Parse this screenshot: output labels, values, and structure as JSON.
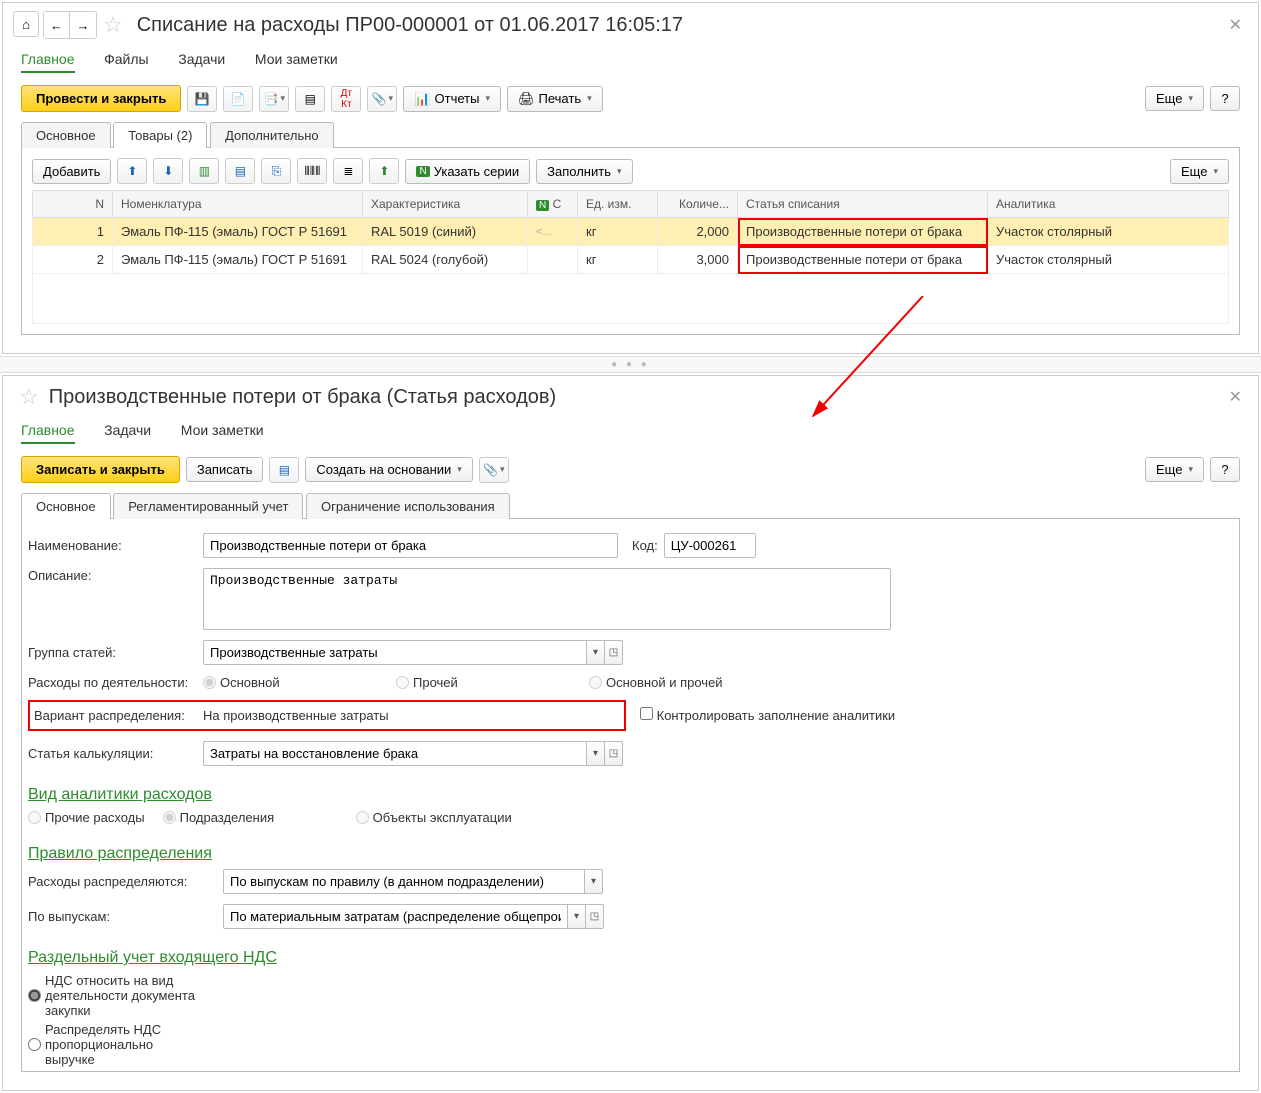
{
  "upper": {
    "title": "Списание на расходы ПР00-000001 от 01.06.2017 16:05:17",
    "nav_tabs": [
      "Главное",
      "Файлы",
      "Задачи",
      "Мои заметки"
    ],
    "primary_btn": "Провести и закрыть",
    "reports_btn": "Отчеты",
    "print_btn": "Печать",
    "more_btn": "Еще",
    "help_btn": "?",
    "sub_tabs": [
      "Основное",
      "Товары (2)",
      "Дополнительно"
    ],
    "add_btn": "Добавить",
    "series_btn": "Указать серии",
    "fill_btn": "Заполнить",
    "table": {
      "headers": {
        "n": "N",
        "nom": "Номенклатура",
        "char": "Характеристика",
        "c": "С",
        "uom": "Ед. изм.",
        "qty": "Количе...",
        "writeoff": "Статья списания",
        "analytics": "Аналитика"
      },
      "rows": [
        {
          "n": "1",
          "nom": "Эмаль ПФ-115 (эмаль) ГОСТ Р 51691",
          "char": "RAL 5019 (синий)",
          "c": "<...",
          "uom": "кг",
          "qty": "2,000",
          "writeoff": "Производственные потери от брака",
          "analytics": "Участок столярный"
        },
        {
          "n": "2",
          "nom": "Эмаль ПФ-115 (эмаль) ГОСТ Р 51691",
          "char": "RAL 5024 (голубой)",
          "c": "",
          "uom": "кг",
          "qty": "3,000",
          "writeoff": "Производственные потери от брака",
          "analytics": "Участок столярный"
        }
      ]
    }
  },
  "lower": {
    "title": "Производственные потери от брака (Статья расходов)",
    "nav_tabs": [
      "Главное",
      "Задачи",
      "Мои заметки"
    ],
    "primary_btn": "Записать и закрыть",
    "save_btn": "Записать",
    "create_based_btn": "Создать на основании",
    "more_btn": "Еще",
    "help_btn": "?",
    "sub_tabs": [
      "Основное",
      "Регламентированный учет",
      "Ограничение использования"
    ],
    "fields": {
      "name_label": "Наименование:",
      "name_value": "Производственные потери от брака",
      "code_label": "Код:",
      "code_value": "ЦУ-000261",
      "desc_label": "Описание:",
      "desc_value": "Производственные затраты",
      "group_label": "Группа статей:",
      "group_value": "Производственные затраты",
      "activity_label": "Расходы по деятельности:",
      "activity_options": [
        "Основной",
        "Прочей",
        "Основной и прочей"
      ],
      "variant_label": "Вариант распределения:",
      "variant_value": "На производственные затраты",
      "control_checkbox": "Контролировать заполнение аналитики",
      "calc_label": "Статья калькуляции:",
      "calc_value": "Затраты на восстановление брака",
      "analytics_head": "Вид аналитики расходов",
      "analytics_options": [
        "Прочие расходы",
        "Подразделения",
        "Объекты эксплуатации"
      ],
      "rule_head": "Правило распределения",
      "dist_label": "Расходы распределяются:",
      "dist_value": "По выпускам по правилу (в данном подразделении)",
      "issues_label": "По выпускам:",
      "issues_value": "По материальным затратам (распределение общепроизводс",
      "vat_head": "Раздельный учет входящего НДС",
      "vat_options": [
        "НДС относить на вид деятельности документа закупки",
        "Распределять НДС пропорционально выручке"
      ]
    }
  }
}
